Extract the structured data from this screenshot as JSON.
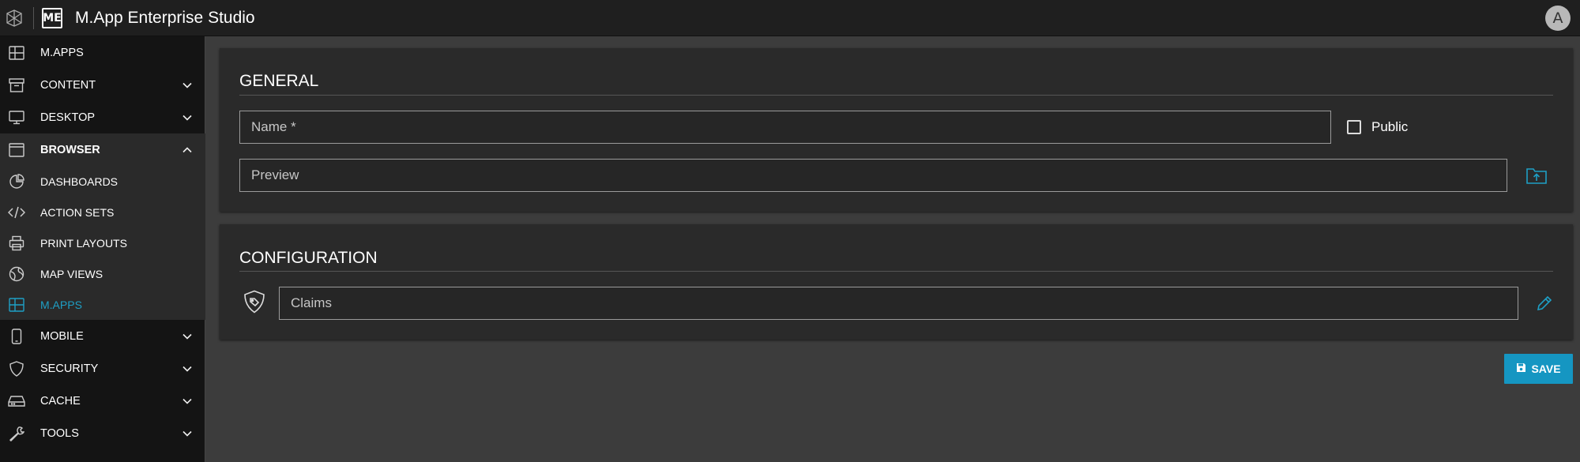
{
  "app": {
    "title": "M.App Enterprise Studio",
    "badge": "ME",
    "avatar_letter": "A"
  },
  "colors": {
    "accent": "#1596c2",
    "active_nav": "#1e9fc5",
    "sidebar_bg": "#141414",
    "panel_bg": "#2a2a2a",
    "page_bg": "#3c3c3c"
  },
  "sidebar": {
    "items": [
      {
        "label": "M.APPS",
        "icon": "grid-icon"
      },
      {
        "label": "CONTENT",
        "icon": "archive-icon",
        "chevron": "chevron-down-icon"
      },
      {
        "label": "DESKTOP",
        "icon": "monitor-icon",
        "chevron": "chevron-down-icon"
      },
      {
        "label": "BROWSER",
        "icon": "browser-window-icon",
        "chevron": "chevron-up-icon"
      },
      {
        "label": "DASHBOARDS",
        "icon": "pie-chart-icon"
      },
      {
        "label": "ACTION SETS",
        "icon": "code-icon"
      },
      {
        "label": "PRINT LAYOUTS",
        "icon": "printer-icon"
      },
      {
        "label": "MAP VIEWS",
        "icon": "globe-icon"
      },
      {
        "label": "M.APPS",
        "icon": "grid-icon"
      },
      {
        "label": "MOBILE",
        "icon": "mobile-icon",
        "chevron": "chevron-down-icon"
      },
      {
        "label": "SECURITY",
        "icon": "shield-icon",
        "chevron": "chevron-down-icon"
      },
      {
        "label": "CACHE",
        "icon": "hard-drive-icon",
        "chevron": "chevron-down-icon"
      },
      {
        "label": "TOOLS",
        "icon": "wrench-icon",
        "chevron": "chevron-down-icon"
      }
    ]
  },
  "general": {
    "heading": "GENERAL",
    "name_placeholder": "Name *",
    "public_label": "Public",
    "preview_placeholder": "Preview",
    "upload_icon": "folder-upload-icon"
  },
  "configuration": {
    "heading": "CONFIGURATION",
    "claims_value": "Claims",
    "claims_icon": "shield-tag-icon",
    "edit_icon": "pencil-icon"
  },
  "actions": {
    "save_label": "SAVE",
    "save_icon": "floppy-disk-icon"
  }
}
